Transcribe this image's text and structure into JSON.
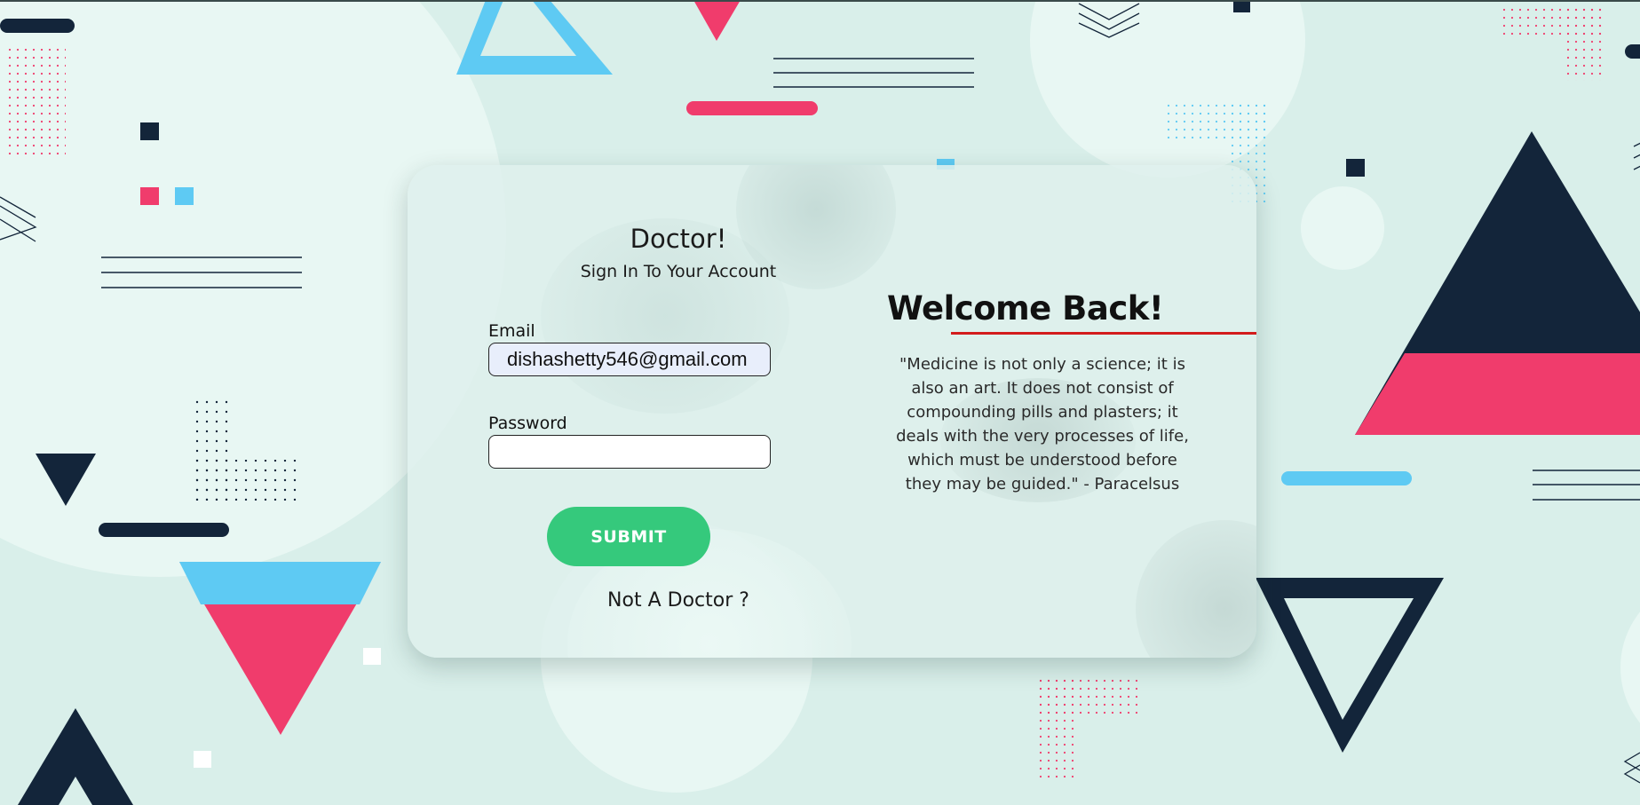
{
  "login": {
    "title": "Doctor!",
    "subtitle": "Sign In To Your Account",
    "email_label": "Email",
    "email_value": "dishashetty546@gmail.com",
    "password_label": "Password",
    "password_value": "",
    "submit_label": "SUBMIT",
    "alt_link": "Not A Doctor ?"
  },
  "welcome": {
    "heading": "Welcome Back!",
    "quote": "\"Medicine is not only a science; it is also an art. It does not consist of compounding pills and plasters; it deals with the very processes of life, which must be understood before they may be guided.\" - Paracelsus"
  },
  "colors": {
    "background": "#d9efea",
    "navy": "#13253a",
    "pink": "#f03c6c",
    "sky": "#5ecaf3",
    "submit": "#35c97c",
    "underline": "#d31c1c"
  }
}
